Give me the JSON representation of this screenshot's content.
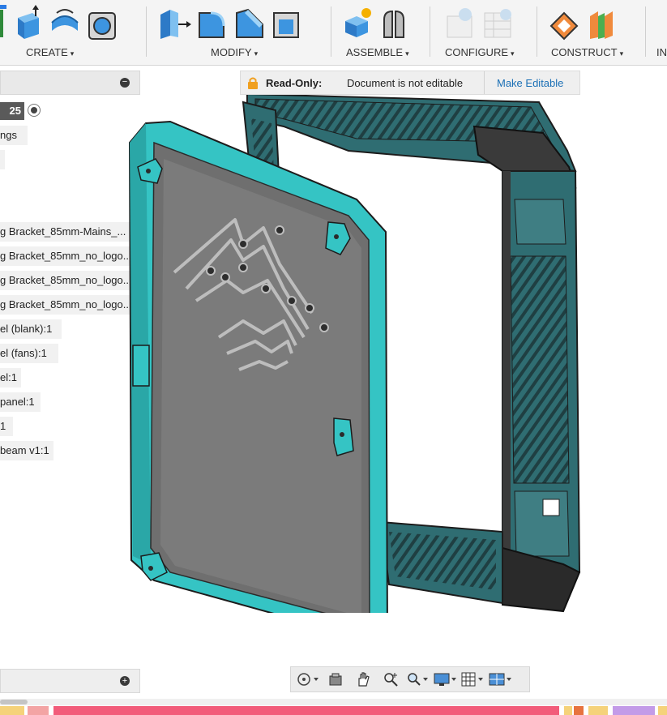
{
  "toolbar": {
    "create_label": "CREATE",
    "modify_label": "MODIFY",
    "assemble_label": "ASSEMBLE",
    "configure_label": "CONFIGURE",
    "construct_label": "CONSTRUCT",
    "inspect_label": "IN",
    "caret": "▾"
  },
  "browser": {
    "version_number": "25",
    "collapse_symbol": "−",
    "expand_symbol": "+",
    "items": [
      {
        "label": "ngs"
      },
      {
        "label": "g Bracket_85mm-Mains_..."
      },
      {
        "label": "g Bracket_85mm_no_logo..."
      },
      {
        "label": "g Bracket_85mm_no_logo..."
      },
      {
        "label": "g Bracket_85mm_no_logo..."
      },
      {
        "label": "el (blank):1"
      },
      {
        "label": "el (fans):1"
      },
      {
        "label": "el:1"
      },
      {
        "label": "panel:1"
      },
      {
        "label": "1"
      },
      {
        "label": "beam v1:1"
      }
    ]
  },
  "banner": {
    "title": "Read-Only:",
    "message": "Document is not editable",
    "action": "Make Editable"
  },
  "colors": {
    "accent_cyan": "#35c4c4",
    "frame_teal": "#2e6f73",
    "dark_grey": "#333333",
    "link_blue": "#1a6fb5",
    "lock_orange": "#f0a020",
    "timeline_pink": "#f25c7a"
  },
  "icons": {
    "navbar": [
      "orbit-icon",
      "look-at-icon",
      "pan-icon",
      "zoom-window-icon",
      "zoom-icon",
      "display-settings-icon",
      "grid-icon",
      "viewports-icon"
    ]
  }
}
